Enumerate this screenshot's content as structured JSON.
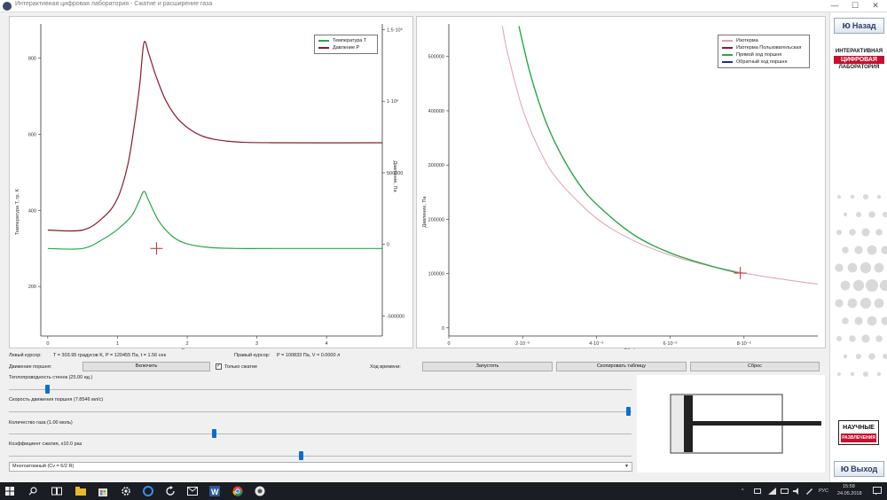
{
  "window": {
    "title": "Интерактивная цифровая лаборатория - Сжатие и расширение газа",
    "minimize": "—",
    "maximize": "☐",
    "close": "✕"
  },
  "left_chart": {
    "legend": [
      {
        "label": "Температура T",
        "color": "#2aa845"
      },
      {
        "label": "Давление P",
        "color": "#8b1a2e"
      }
    ],
    "xlabel": "Время, сек",
    "ylabel_left": "Температура T, гр. K",
    "ylabel_right": "Давление, Па",
    "x_ticks": [
      "0",
      "1",
      "2",
      "3",
      "4"
    ],
    "y_ticks_left": [
      "200",
      "400",
      "600",
      "800"
    ],
    "y_ticks_right": [
      "-500000",
      "0",
      "500000",
      "1·10⁶",
      "1,5·10⁶"
    ]
  },
  "right_chart": {
    "legend": [
      {
        "label": "Изотерма",
        "color": "#e0a0b0"
      },
      {
        "label": "Изотерма Пользовательская",
        "color": "#8b1a2e"
      },
      {
        "label": "Прямой ход поршня",
        "color": "#2aa845"
      },
      {
        "label": "Обратный ход поршня",
        "color": "#2a2a8a"
      }
    ],
    "xlabel": "Объём, л",
    "ylabel": "Давление, Па",
    "x_ticks": [
      "0",
      "2·10⁻⁶",
      "4·10⁻⁶",
      "6·10⁻⁶",
      "8·10⁻⁶"
    ],
    "y_ticks": [
      "0",
      "100000",
      "200000",
      "300000",
      "400000",
      "500000"
    ]
  },
  "chart_data": [
    {
      "type": "line",
      "xlabel": "Время, сек",
      "ylabel": "Температура T, гр. K",
      "y2label": "Давление, Па",
      "xlim": [
        -0.1,
        4.8
      ],
      "ylim": [
        70,
        890
      ],
      "y2lim": [
        -640000,
        1540000
      ],
      "series": [
        {
          "name": "Температура T",
          "axis": "left",
          "x": [
            0,
            0.5,
            0.8,
            1.0,
            1.2,
            1.3,
            1.38,
            1.45,
            1.6,
            1.8,
            2.0,
            2.3,
            2.7,
            3.2,
            4.8
          ],
          "y": [
            300,
            300,
            325,
            350,
            385,
            420,
            450,
            425,
            370,
            330,
            312,
            303,
            300,
            300,
            300
          ]
        },
        {
          "name": "Давление P",
          "axis": "right",
          "x": [
            0,
            0.5,
            0.8,
            1.0,
            1.15,
            1.25,
            1.32,
            1.38,
            1.45,
            1.55,
            1.7,
            1.9,
            2.2,
            2.6,
            3.2,
            4.8
          ],
          "y": [
            100000,
            100000,
            190000,
            320000,
            560000,
            860000,
            1120000,
            1410000,
            1330000,
            1180000,
            1000000,
            860000,
            760000,
            720000,
            710000,
            710000
          ]
        }
      ],
      "cursor": {
        "x": 1.56,
        "y": 300
      }
    },
    {
      "type": "line",
      "xlabel": "Объём, л",
      "ylabel": "Давление, Па",
      "xlim": [
        0,
        1e-05
      ],
      "ylim": [
        -15000,
        560000
      ],
      "series": [
        {
          "name": "Изотерма",
          "x": [
            1.45e-06,
            1.6e-06,
            2e-06,
            2.5e-06,
            3e-06,
            4e-06,
            5e-06,
            6e-06,
            7e-06,
            8e-06,
            8.8e-06,
            9.5e-06,
            1e-05
          ],
          "y": [
            556000,
            504000,
            403000,
            322000,
            269000,
            202000,
            161000,
            134000,
            115000,
            101000,
            92000,
            85000,
            80500
          ]
        },
        {
          "name": "Прямой ход поршня",
          "x": [
            1.9e-06,
            2.2e-06,
            2.6e-06,
            3e-06,
            3.5e-06,
            4e-06,
            5e-06,
            6e-06,
            7e-06,
            7.85e-06
          ],
          "y": [
            556000,
            470000,
            385000,
            325000,
            268000,
            228000,
            172000,
            138000,
            116000,
            101000
          ]
        }
      ],
      "cursor": {
        "x": 7.9e-06,
        "y": 100900
      }
    }
  ],
  "status": {
    "left_cursor_label": "Левый курсор:",
    "left_cursor_value": "T = 303.95 градусов K,      P = 120455 Па,      t = 1.56 сек",
    "right_cursor_label": "Правый курсор:",
    "right_cursor_value": "P = 100833 Па,      V = 0.0000 л"
  },
  "controls": {
    "piston_label": "Движение поршня:",
    "enable_button": "Включить",
    "only_compression_label": "Только сжатие",
    "only_compression_checked": "✓",
    "time_label": "Ход времени:",
    "start_button": "Запустить",
    "copy_button": "Скопировать таблицу",
    "reset_button": "Сброс",
    "sliders": [
      {
        "label": "Теплопроводность стенок (25.00 ед.)",
        "fraction": 0.06
      },
      {
        "label": "Скорость движения поршня (7.8546 мл/с)",
        "fraction": 1.0
      },
      {
        "label": "Количество газа (1.00 моль)",
        "fraction": 0.33
      },
      {
        "label": "Коэффициент сжатия, x10.0 раз",
        "fraction": 0.47
      }
    ],
    "process_select": "Многоатомный  (Cv = 6/2 R)",
    "select_arrow": "▼"
  },
  "sidebar": {
    "back_button": "Назад",
    "back_icon": "ю",
    "logo_lines": [
      "ИНТЕРАКТИВНАЯ",
      "ЦИФРОВАЯ",
      "ЛАБОРАТОРИЯ"
    ],
    "brand_lines": [
      "НАУЧНЫЕ",
      "РАЗВЛЕЧЕНИЯ"
    ],
    "exit_button": "Выход",
    "exit_icon": "ю"
  },
  "taskbar": {
    "lang": "РУС",
    "time": "15:58",
    "date": "24.05.2018",
    "up_arrow": "^"
  },
  "colors": {
    "temperature": "#2aa845",
    "pressure": "#8b1a2e",
    "isotherm": "#e0a0b0",
    "forward": "#2aa845",
    "cursor": "#c0302a",
    "slider_thumb": "#0a6fcc"
  }
}
